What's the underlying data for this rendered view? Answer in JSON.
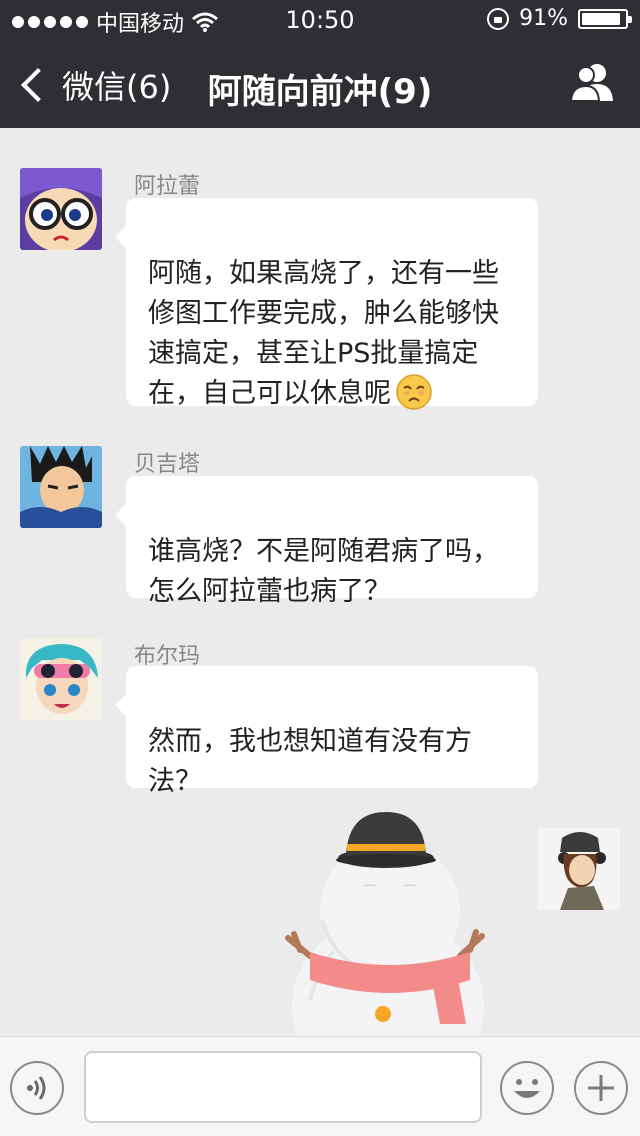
{
  "status_bar": {
    "carrier": "中国移动",
    "time": "10:50",
    "battery_percent": "91%",
    "battery_level": 0.91,
    "signal_dots": 5
  },
  "nav": {
    "back_label": "微信(6)",
    "title": "阿随向前冲(9)",
    "contacts_icon": "group-icon"
  },
  "messages": [
    {
      "sender": "阿拉蕾",
      "text": "阿随，如果高烧了，还有一些\n修图工作要完成，肿么能够快\n速搞定，甚至让PS批量搞定\n在，自己可以休息呢",
      "emoji": "sad-face-emoji"
    },
    {
      "sender": "贝吉塔",
      "text": "谁高烧？不是阿随君病了吗，\n怎么阿拉蕾也病了？"
    },
    {
      "sender": "布尔玛",
      "text": "然而，我也想知道有没有方\n法？"
    }
  ],
  "sticker": {
    "icon": "snowman-sticker",
    "colors": {
      "hat": "#3b3b3b",
      "band": "#f5a623",
      "scarf": "#f38b8b",
      "button": "#f5a623"
    }
  },
  "input_bar": {
    "voice_icon": "voice-icon",
    "emoji_icon": "smiley-icon",
    "add_icon": "plus-icon",
    "text_value": ""
  },
  "colors": {
    "nav_bg": "#2e2f33",
    "chat_bg": "#ebebeb",
    "bubble_in": "#ffffff",
    "sender_name": "#888888"
  }
}
